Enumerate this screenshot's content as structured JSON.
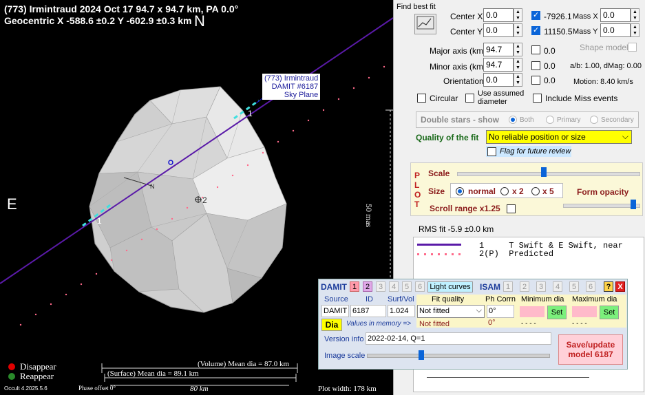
{
  "plot": {
    "title_line1": "(773) Irmintraud  2024 Oct 17  94.7 x 94.7 km, PA 0.0°",
    "title_line2": "Geocentric  X  -588.6 ±0.2  Y -602.9 ±0.3 km",
    "north": "N",
    "east": "E",
    "model_label": [
      "(773) Irmintraud",
      "DAMIT #6187",
      "Sky Plane"
    ],
    "scale_vertical": "50 mas",
    "chord1_a": "1",
    "chord1_b": "1",
    "center_marker": "2",
    "axis_n": "N",
    "volume_dia": "(Volume) Mean dia = 87.0 km",
    "surface_dia": "(Surface) Mean dia = 89.1 km",
    "disappear": "Disappear",
    "reappear": "Reappear",
    "version": "Occult 4.2025.5.6",
    "phase_offset": "Phase offset 0°",
    "scale_km": "80 km",
    "plot_width": "Plot width: 178 km",
    "colors": {
      "disappear": "#e00000",
      "reappear": "#2a8a2a",
      "chord_line": "#5a1aa8"
    }
  },
  "fit": {
    "header": "Find best fit",
    "center_x_label": "Center X",
    "center_x": "0.0",
    "center_y_label": "Center Y",
    "center_y": "0.0",
    "mass_x_value": "-7926.1",
    "mass_x_label": "Mass X",
    "mass_x": "0.0",
    "mass_y_value": "11150.5",
    "mass_y_label": "Mass Y",
    "mass_y": "0.0",
    "major_label": "Major axis (km)",
    "major": "94.7",
    "major_extra": "0.0",
    "shape_model": "Shape model",
    "minor_label": "Minor axis (km)",
    "minor": "94.7",
    "minor_extra": "0.0",
    "ab_info": "a/b: 1.00, dMag: 0.00",
    "orient_label": "Orientation",
    "orient": "0.0",
    "orient_extra": "0.0",
    "motion": "Motion: 8.40 km/s",
    "circular": "Circular",
    "assumed_dia": "Use assumed diameter",
    "include_miss": "Include Miss events",
    "double_stars": "Double stars - show",
    "both": "Both",
    "primary": "Primary",
    "secondary": "Secondary",
    "quality_label": "Quality of the fit",
    "quality_value": "No reliable position or size",
    "flag_future": "Flag for future review"
  },
  "plotctl": {
    "side": [
      "P",
      "L",
      "O",
      "T"
    ],
    "scale": "Scale",
    "size": "Size",
    "normal": "normal",
    "x2": "x 2",
    "x5": "x 5",
    "form_opacity": "Form opacity",
    "scroll_range": "Scroll range x1.25",
    "rms": "RMS fit  -5.9 ±0.0 km"
  },
  "legend": {
    "line1": "1     T Swift & E Swift, near",
    "line2": "2(P)  Predicted"
  },
  "damit": {
    "title": "DAMIT",
    "nums": [
      "1",
      "2",
      "3",
      "4",
      "5",
      "6"
    ],
    "light_curves": "Light curves",
    "isam": "ISAM",
    "isam_nums": [
      "1",
      "2",
      "3",
      "4",
      "5",
      "6"
    ],
    "help": "?",
    "close": "X",
    "source_h": "Source",
    "id_h": "ID",
    "surfvol_h": "Surf/Vol",
    "source": "DAMIT",
    "id": "6187",
    "surfvol": "1.024",
    "fitq_h": "Fit quality",
    "phcorr_h": "Ph Corrn",
    "mindia_h": "Minimum dia",
    "maxdia_h": "Maximum dia",
    "fitq": "Not fitted",
    "phcorr": "0°",
    "set": "Set",
    "dia": "Dia",
    "values_mem": "Values in memory =>",
    "fitq_mem": "Not fitted",
    "phcorr_mem": "0°",
    "min_mem": "- - - -",
    "max_mem": "- - - -",
    "version_label": "Version info",
    "version": "2022-02-14, Q=1",
    "image_scale": "Image scale",
    "save_update": "Save/update model 6187"
  }
}
